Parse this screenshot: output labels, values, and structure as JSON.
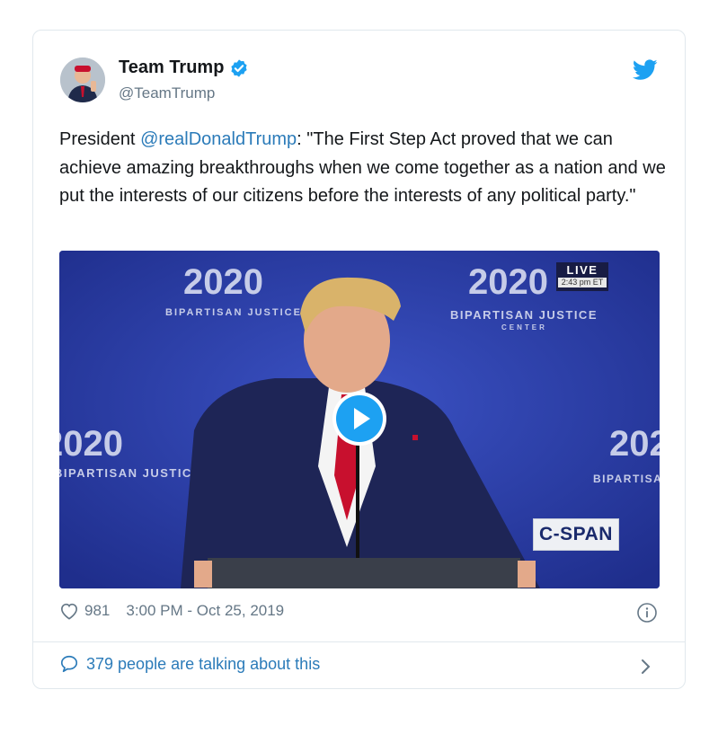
{
  "author": {
    "name": "Team Trump",
    "handle": "@TeamTrump",
    "verified": true,
    "avatar_icon": "profile-photo"
  },
  "tweet": {
    "prefix": "President ",
    "mention": "@realDonaldTrump",
    "body": ": \"The First Step Act proved that we can achieve amazing breakthroughs when we come together as a nation and we put the interests of our citizens before the interests of any political party.\""
  },
  "media": {
    "live_label": "LIVE",
    "live_time": "2:43 pm ET",
    "network_logo": "C-SPAN",
    "backdrop_logo_number": "2020",
    "backdrop_logo_text": "BIPARTISAN JUSTICE",
    "backdrop_logo_sub": "CENTER",
    "play_icon": "play-icon"
  },
  "meta": {
    "likes": "981",
    "timestamp": "3:00 PM - Oct 25, 2019"
  },
  "footer": {
    "talking": "379 people are talking about this"
  },
  "colors": {
    "link": "#2b7bb9",
    "twitter_blue": "#1da1f2",
    "muted": "#657786",
    "backdrop": "#2c3fa8"
  }
}
